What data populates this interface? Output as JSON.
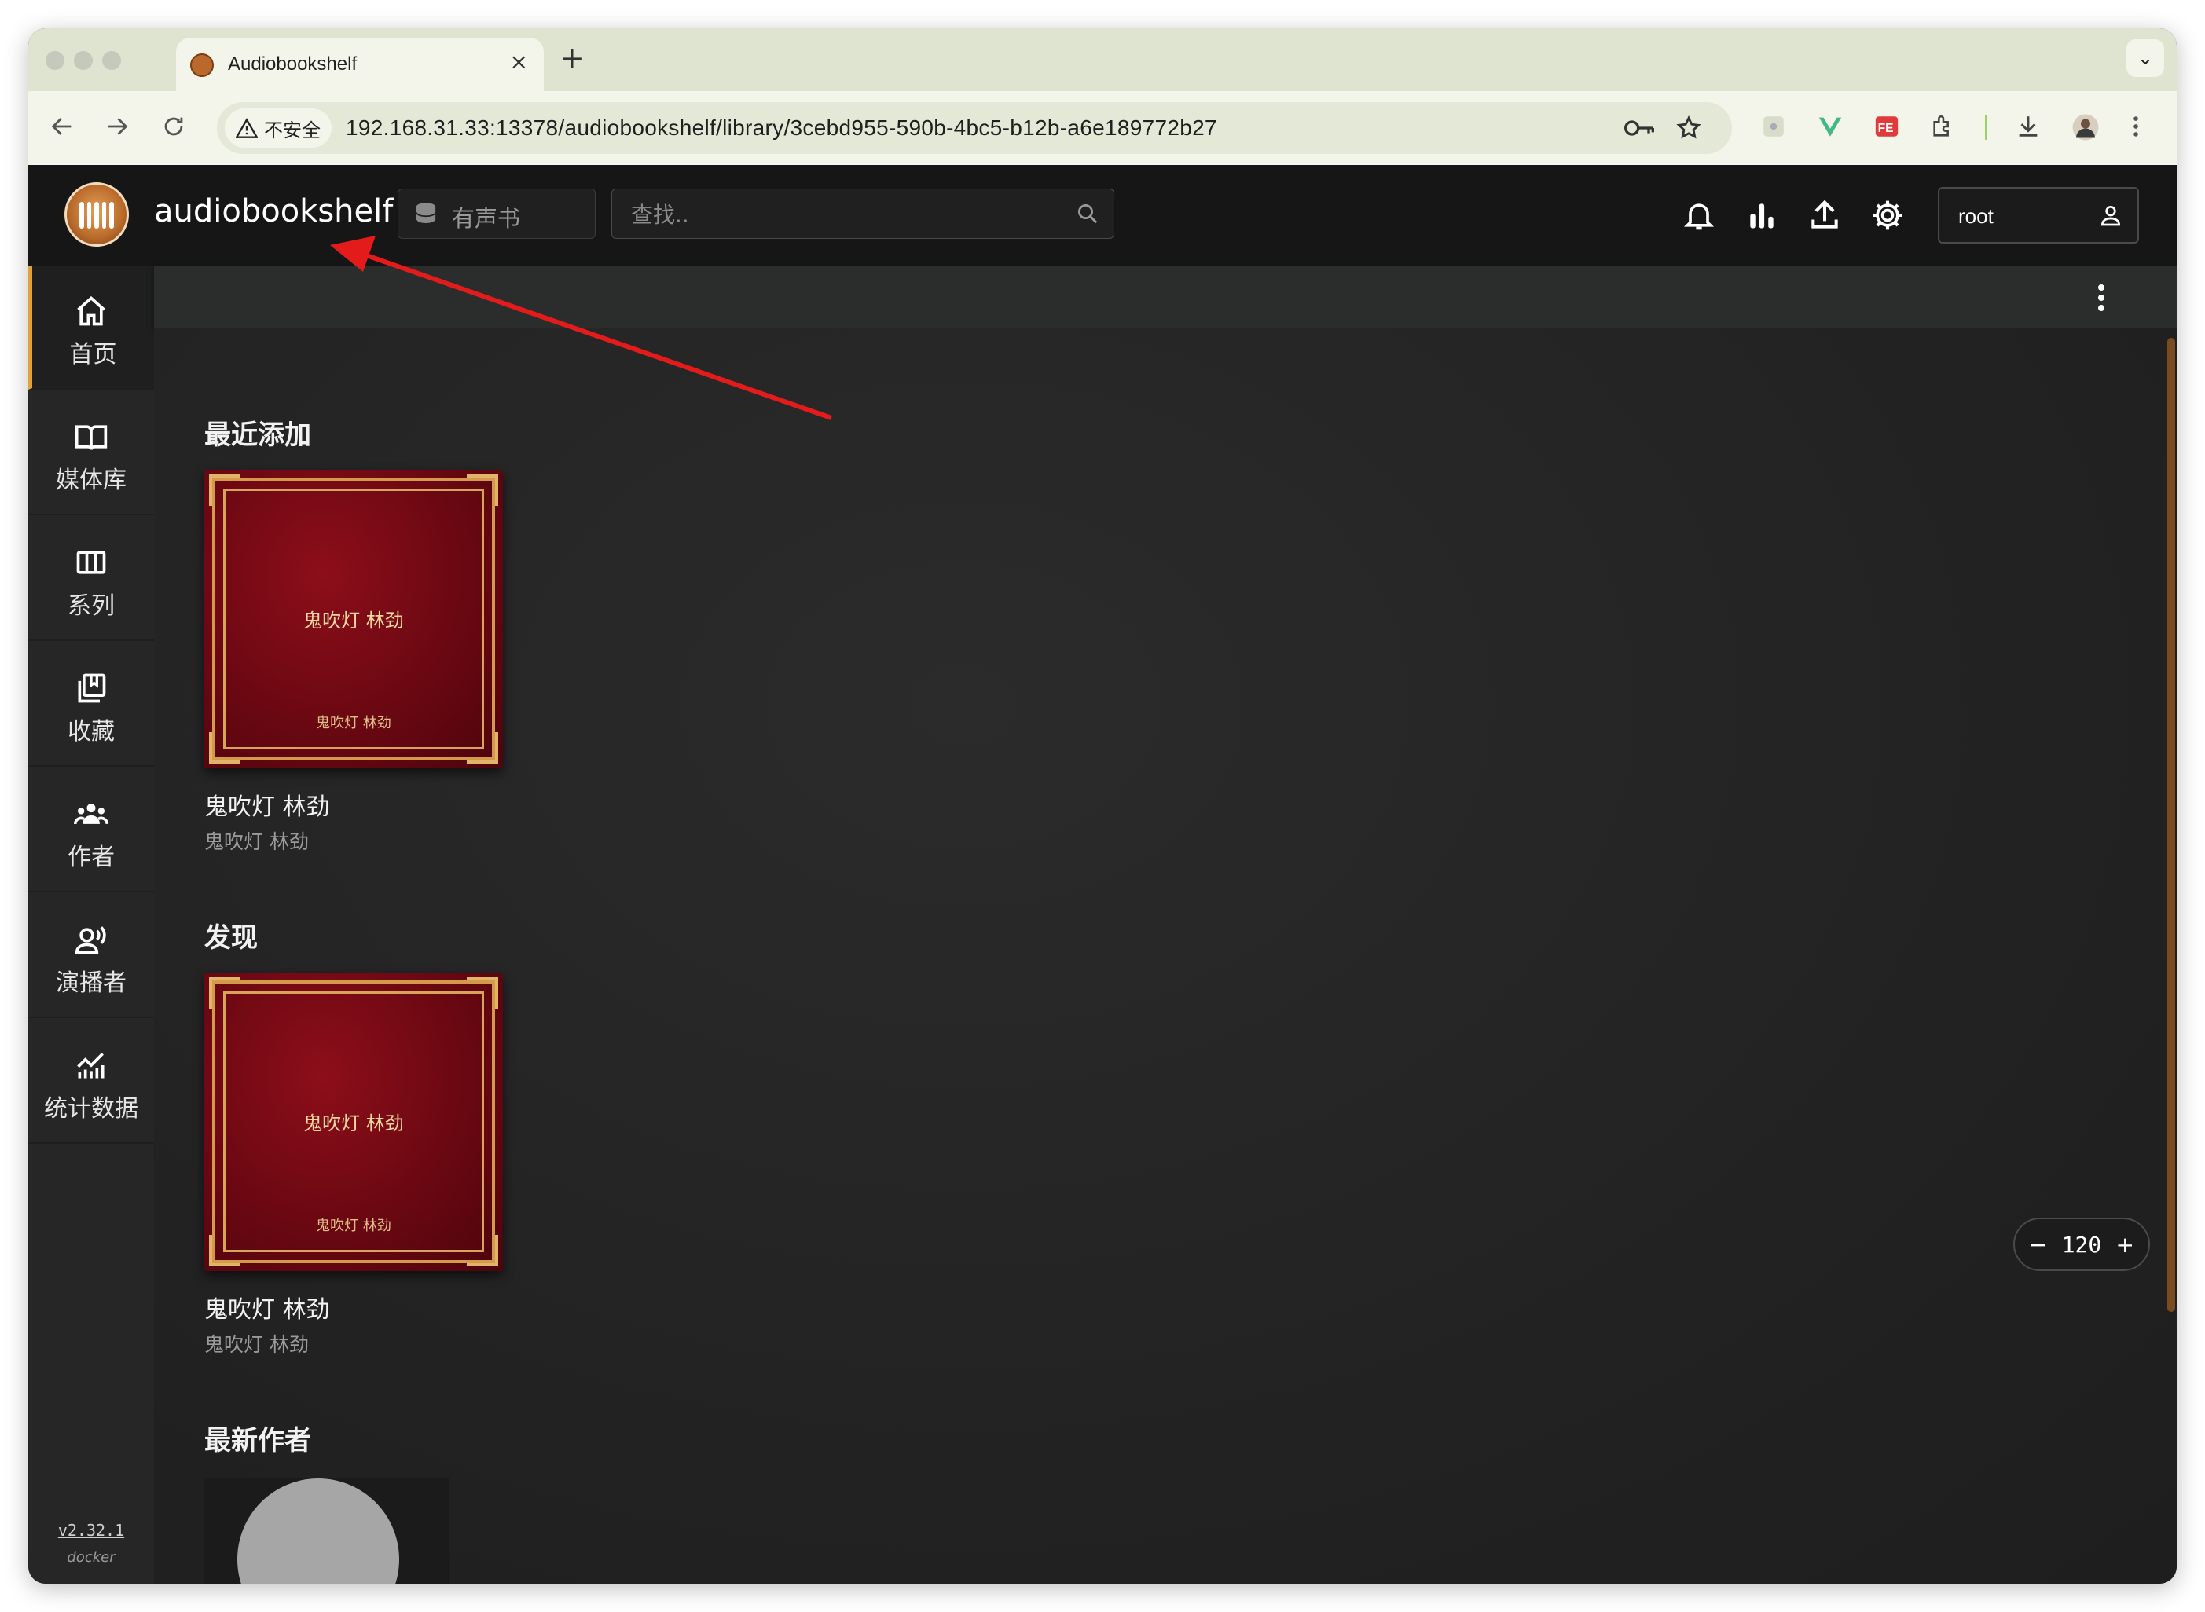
{
  "browser": {
    "tab_title": "Audiobookshelf",
    "tab_close": "×",
    "new_tab": "+",
    "tab_menu": "⌄",
    "security_label": "不安全",
    "url": "192.168.31.33:13378/audiobookshelf/library/3cebd955-590b-4bc5-b12b-a6e189772b27",
    "icons": [
      "back-icon",
      "forward-icon",
      "reload-icon",
      "key-icon",
      "star-icon",
      "extension-icons",
      "download-icon",
      "profile-icon",
      "menu-icon"
    ]
  },
  "header": {
    "app_name": "audiobookshelf",
    "library": "有声书",
    "search_placeholder": "查找.."
  },
  "user": {
    "name": "root"
  },
  "sidebar": {
    "items": [
      {
        "label": "首页",
        "icon": "home-icon",
        "active": true
      },
      {
        "label": "媒体库",
        "icon": "book-open-icon",
        "active": false
      },
      {
        "label": "系列",
        "icon": "columns-icon",
        "active": false
      },
      {
        "label": "收藏",
        "icon": "collection-icon",
        "active": false
      },
      {
        "label": "作者",
        "icon": "people-icon",
        "active": false
      },
      {
        "label": "演播者",
        "icon": "narrator-icon",
        "active": false
      },
      {
        "label": "统计数据",
        "icon": "stats-icon",
        "active": false
      }
    ],
    "version": "v2.32.1",
    "build": "docker"
  },
  "sections": {
    "recent": {
      "title": "最近添加",
      "book": {
        "cover_title": "鬼吹灯 林劲",
        "cover_author": "鬼吹灯 林劲",
        "title": "鬼吹灯 林劲",
        "author": "鬼吹灯 林劲"
      }
    },
    "discover": {
      "title": "发现",
      "book": {
        "cover_title": "鬼吹灯 林劲",
        "cover_author": "鬼吹灯 林劲",
        "title": "鬼吹灯 林劲",
        "author": "鬼吹灯 林劲"
      }
    },
    "new_authors": {
      "title": "最新作者"
    }
  },
  "zoom": {
    "minus": "−",
    "value": "120",
    "plus": "+"
  },
  "colors": {
    "accent": "#e8a036",
    "annotation_arrow": "#e31b1b",
    "header_bg": "#161616",
    "sidebar_bg": "#262626"
  }
}
